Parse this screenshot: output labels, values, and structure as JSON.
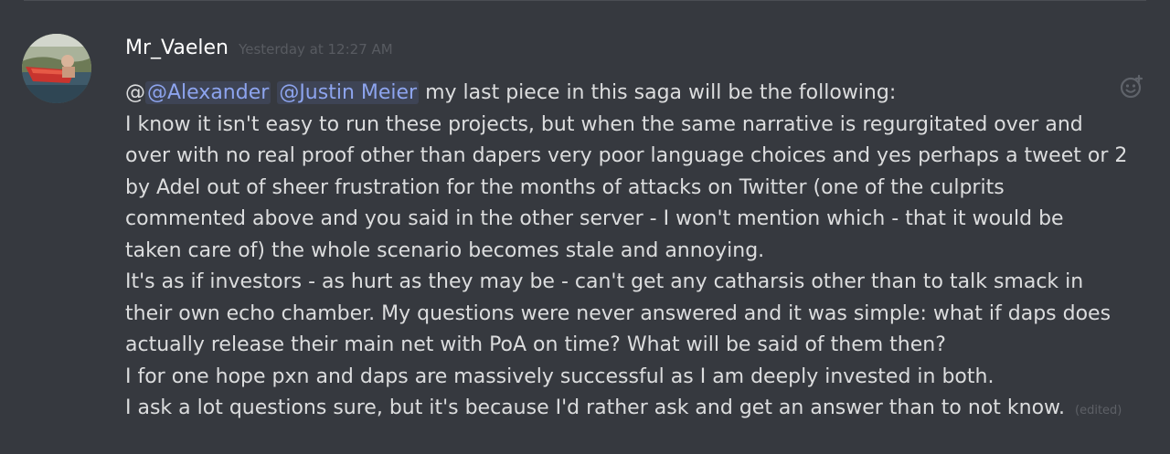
{
  "message": {
    "author": "Mr_Vaelen",
    "timestamp": "Yesterday at 12:27 AM",
    "at_sign": "@",
    "mentions": [
      "@Alexander",
      "@Justin Meier"
    ],
    "first_line_rest": " my last piece in this saga will be the following:",
    "lines": [
      "I know it isn't easy to run these projects, but when the same narrative is regurgitated over and",
      "over with no real proof other than dapers very poor language choices and yes perhaps a tweet or 2",
      "by Adel out of sheer frustration for the months of attacks on Twitter (one of the culprits",
      "commented above and you said in the other server - I won't mention which - that it would be",
      "taken care of) the whole scenario becomes stale and annoying.",
      "It's as if investors - as hurt as they may be - can't get any catharsis other than to talk smack in",
      "their own echo chamber. My questions were never answered and it was simple: what if daps does",
      "actually release their main net with PoA on time? What will be said of them then?",
      "I for one hope pxn and daps are massively successful as I am deeply invested in both.",
      "I ask a lot questions sure, but it's because I'd rather ask and get an answer than to not know."
    ],
    "edited_label": "(edited)"
  },
  "icons": {
    "avatar": "avatar-boat-photo",
    "reaction": "add-reaction-smiley-icon"
  },
  "colors": {
    "background": "#36393f",
    "text": "#dcddde",
    "username": "#ffffff",
    "timestamp": "#585b61",
    "mention": "#8da4ee",
    "edited": "#5d6066"
  }
}
